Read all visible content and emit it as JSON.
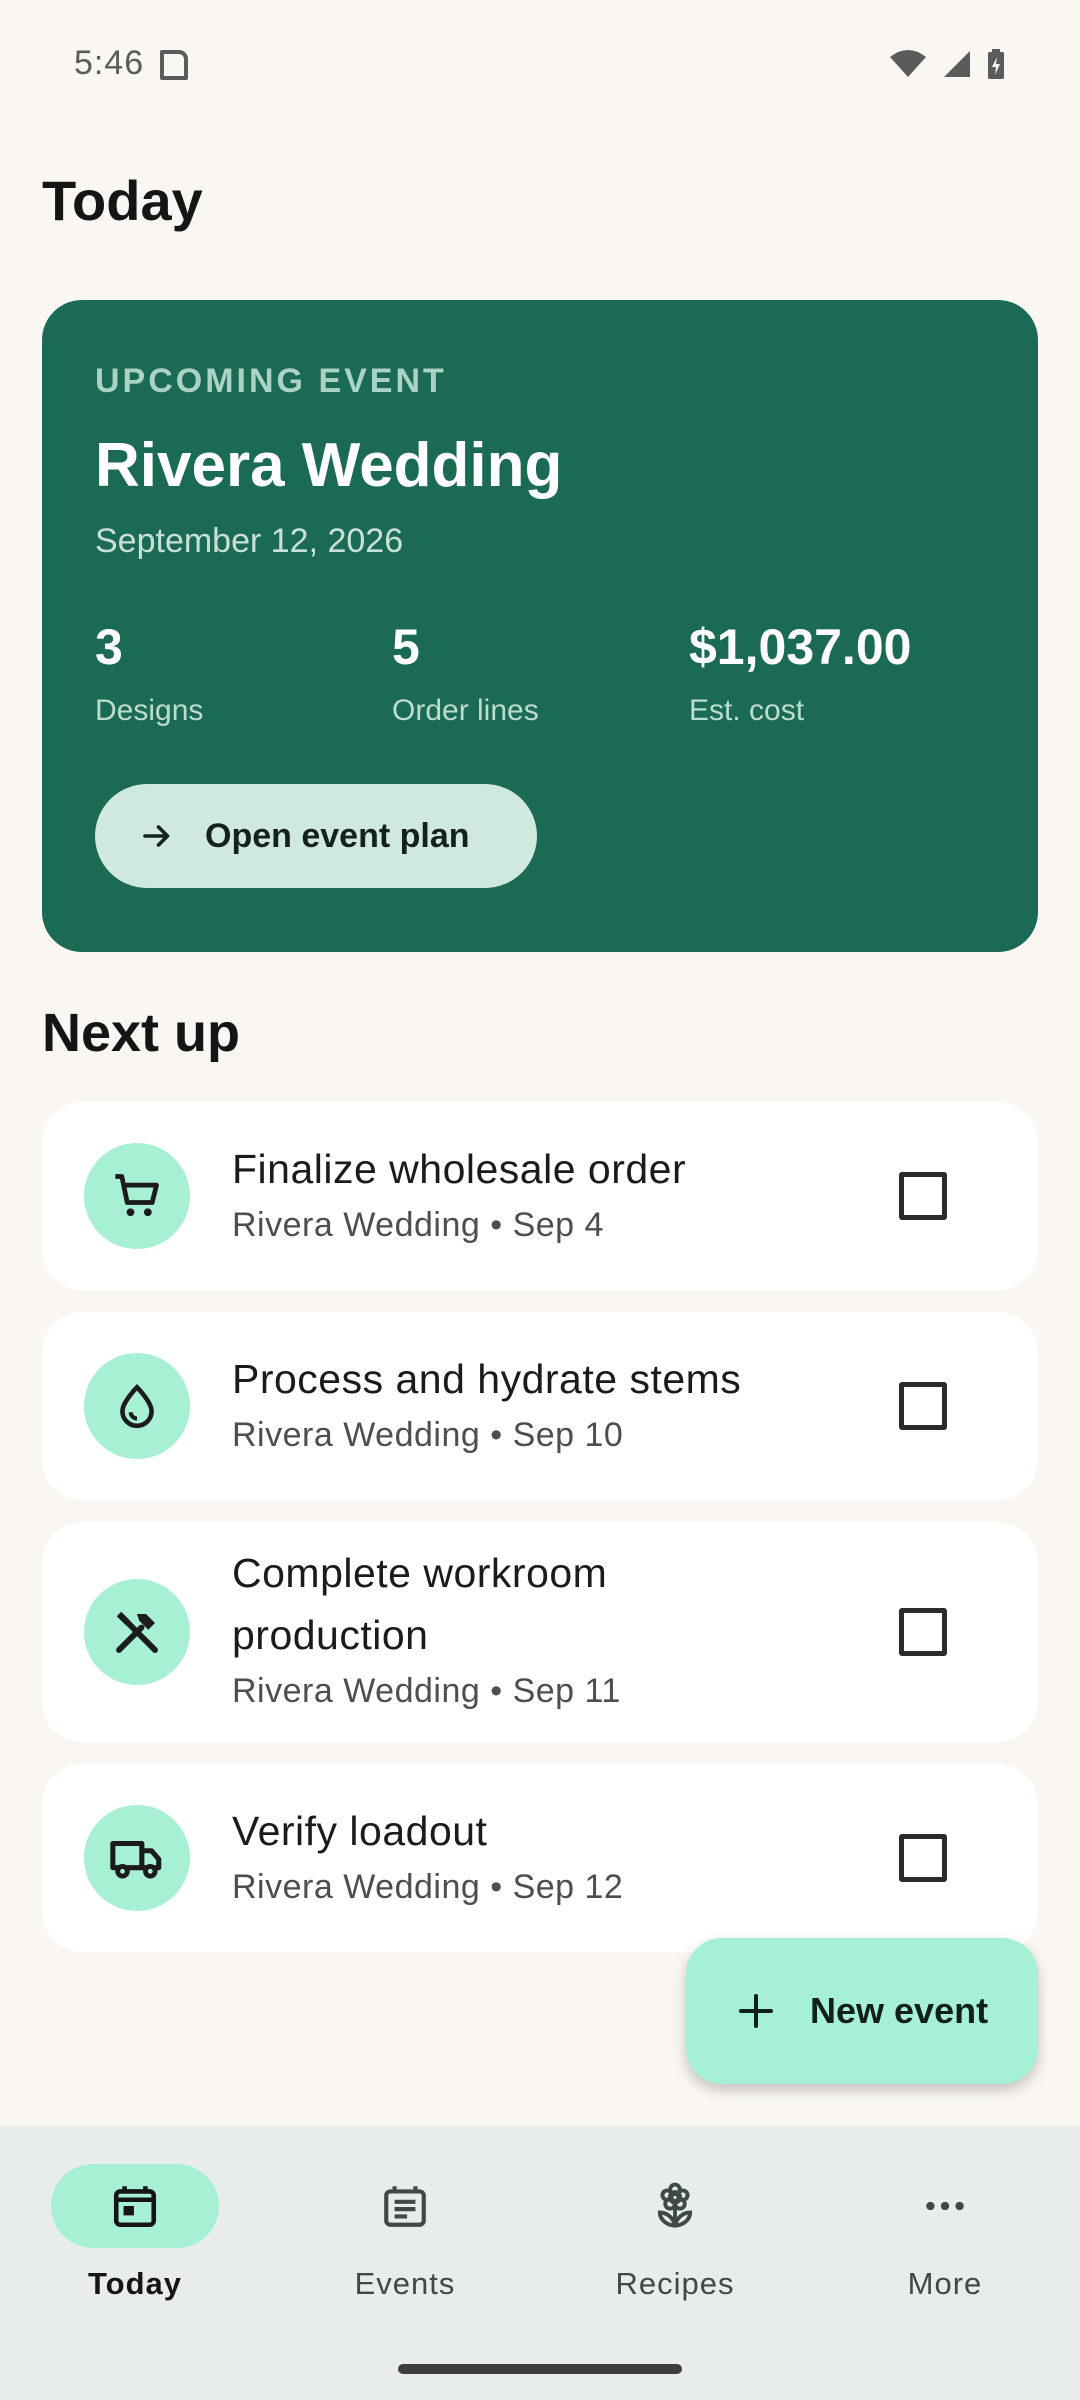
{
  "status_bar": {
    "time": "5:46"
  },
  "page_title": "Today",
  "upcoming": {
    "kicker": "UPCOMING EVENT",
    "title": "Rivera Wedding",
    "date": "September 12, 2026",
    "stats": [
      {
        "value": "3",
        "label": "Designs"
      },
      {
        "value": "5",
        "label": "Order lines"
      },
      {
        "value": "$1,037.00",
        "label": "Est. cost"
      }
    ],
    "button_label": "Open event plan"
  },
  "next_up": {
    "title": "Next up",
    "tasks": [
      {
        "icon": "cart-icon",
        "title_lines": [
          "Finalize wholesale order"
        ],
        "meta": "Rivera Wedding • Sep 4",
        "checked": false
      },
      {
        "icon": "water-drop-icon",
        "title_lines": [
          "Process and hydrate stems"
        ],
        "meta": "Rivera Wedding • Sep 10",
        "checked": false
      },
      {
        "icon": "tools-icon",
        "title_lines": [
          "Complete workroom",
          "production"
        ],
        "meta": "Rivera Wedding • Sep 11",
        "checked": false
      },
      {
        "icon": "truck-icon",
        "title_lines": [
          "Verify loadout"
        ],
        "meta": "Rivera Wedding • Sep 12",
        "checked": false
      }
    ]
  },
  "fab": {
    "label": "New event",
    "icon": "plus-icon"
  },
  "nav": {
    "items": [
      {
        "label": "Today",
        "icon": "calendar-today-icon",
        "active": true
      },
      {
        "label": "Events",
        "icon": "event-list-icon",
        "active": false
      },
      {
        "label": "Recipes",
        "icon": "flower-icon",
        "active": false
      },
      {
        "label": "More",
        "icon": "more-dots-icon",
        "active": false
      }
    ]
  },
  "colors": {
    "background": "#faf7f2",
    "hero": "#1b6a55",
    "accent_mint": "#a7f0d4",
    "hero_button": "#cfe9de",
    "nav_background": "#e8ede9"
  }
}
